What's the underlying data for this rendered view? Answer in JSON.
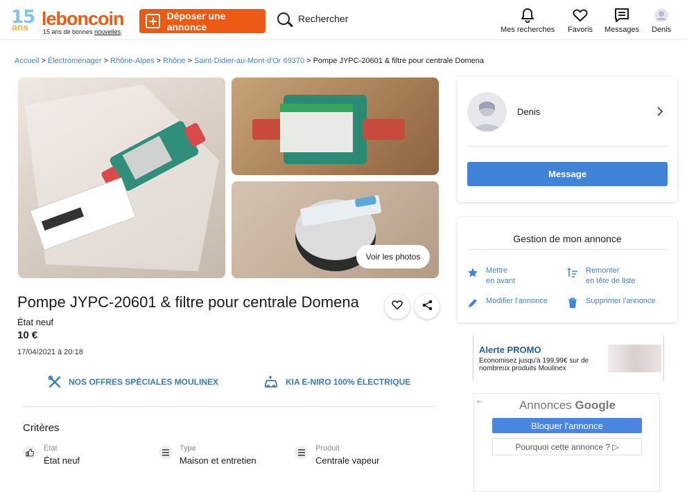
{
  "header": {
    "logo_years": "15",
    "logo_ans": "ans",
    "logo_brand": "leboncoin",
    "logo_tagline_prefix": "15 ans de bonnes ",
    "logo_tagline_word": "nouvelles",
    "logo_tagline_suffix": ".",
    "deposit_label": "Déposer une annonce",
    "search_label": "Rechercher",
    "nav": [
      {
        "label": "Mes recherches",
        "icon": "bell-icon"
      },
      {
        "label": "Favoris",
        "icon": "heart-icon"
      },
      {
        "label": "Messages",
        "icon": "message-icon"
      },
      {
        "label": "Denis",
        "icon": "user-icon"
      }
    ]
  },
  "breadcrumb": {
    "items": [
      "Accueil",
      "Électroménager",
      "Rhône-Alpes",
      "Rhône",
      "Saint-Didier-au-Mont-d'Or 69370"
    ],
    "separator": ">",
    "current": "Pompe JYPC-20601 & filtre pour centrale Domena"
  },
  "gallery": {
    "see_photos": "Voir les photos"
  },
  "listing": {
    "title": "Pompe JYPC-20601 & filtre pour centrale Domena",
    "condition": "État neuf",
    "price": "10 €",
    "date": "17/04/2021 à 20:18"
  },
  "promos": [
    {
      "label": "NOS OFFRES SPÉCIALES MOULINEX",
      "icon": "tools-icon"
    },
    {
      "label": "KIA E-NIRO 100% ÉLECTRIQUE",
      "icon": "car-icon"
    }
  ],
  "criteria": {
    "title": "Critères",
    "items": [
      {
        "label": "État",
        "value": "État neuf",
        "icon": "thumbs-up-icon"
      },
      {
        "label": "Type",
        "value": "Maison et entretien",
        "icon": "list-icon"
      },
      {
        "label": "Produit",
        "value": "Centrale vapeur",
        "icon": "list-icon"
      }
    ]
  },
  "seller": {
    "name": "Denis",
    "message_button": "Message"
  },
  "manage": {
    "title": "Gestion de mon annonce",
    "actions": [
      {
        "line1": "Mettre",
        "line2": "en avant",
        "icon": "star-icon"
      },
      {
        "line1": "Remonter",
        "line2": "en tête de liste",
        "icon": "sort-up-icon"
      },
      {
        "line1": "Modifier l'annonce",
        "line2": "",
        "icon": "pencil-icon"
      },
      {
        "line1": "Supprimer l'annonce",
        "line2": "",
        "icon": "trash-icon"
      }
    ]
  },
  "ad": {
    "title": "Alerte PROMO",
    "text": "Economisez jusqu'à 199,99€ sur de nombreux produits Moulinex"
  },
  "google_ads": {
    "header_prefix": "Annonces ",
    "header_brand": "Google",
    "block_button": "Bloquer l'annonce",
    "why_button": "Pourquoi cette annonce ? ▷"
  },
  "colors": {
    "brand_orange": "#ec5a13",
    "link_blue": "#4183d7",
    "promo_blue": "#3a7ab8"
  }
}
